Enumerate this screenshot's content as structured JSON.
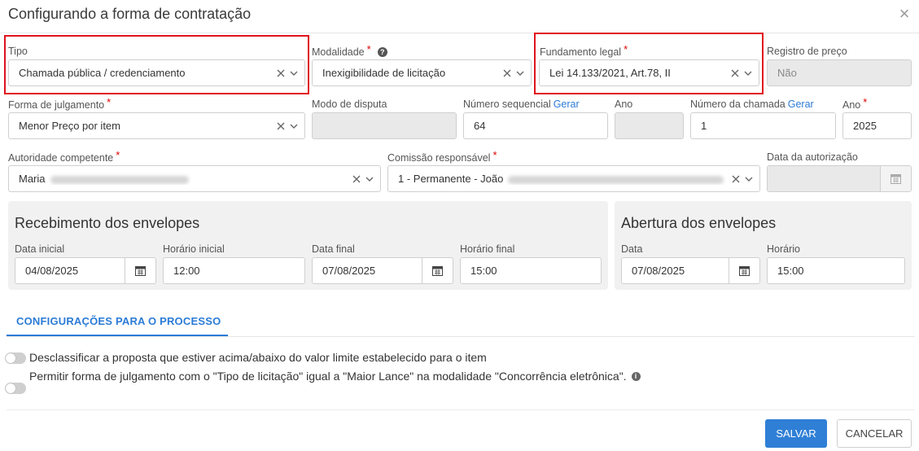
{
  "dialog": {
    "title": "Configurando a forma de contratação"
  },
  "fields": {
    "tipo": {
      "label": "Tipo",
      "value": "Chamada pública / credenciamento"
    },
    "modalidade": {
      "label": "Modalidade",
      "value": "Inexigibilidade de licitação"
    },
    "fundamento": {
      "label": "Fundamento legal",
      "value": "Lei 14.133/2021, Art.78, II"
    },
    "registro_preco": {
      "label": "Registro de preço",
      "value": "Não"
    },
    "forma_julgamento": {
      "label": "Forma de julgamento",
      "value": "Menor Preço por item"
    },
    "modo_disputa": {
      "label": "Modo de disputa",
      "value": ""
    },
    "numero_sequencial": {
      "label": "Número sequencial",
      "link": "Gerar",
      "value": "64"
    },
    "ano_seq": {
      "label": "Ano",
      "value": ""
    },
    "numero_chamada": {
      "label": "Número da chamada",
      "link": "Gerar",
      "value": "1"
    },
    "ano": {
      "label": "Ano",
      "value": "2025"
    },
    "autoridade": {
      "label": "Autoridade competente",
      "value": "Maria"
    },
    "comissao": {
      "label": "Comissão responsável",
      "value": "1 - Permanente - João"
    },
    "data_autorizacao": {
      "label": "Data da autorização",
      "value": ""
    }
  },
  "recebimento": {
    "title": "Recebimento dos envelopes",
    "data_inicial": {
      "label": "Data inicial",
      "value": "04/08/2025"
    },
    "horario_inicial": {
      "label": "Horário inicial",
      "value": "12:00"
    },
    "data_final": {
      "label": "Data final",
      "value": "07/08/2025"
    },
    "horario_final": {
      "label": "Horário final",
      "value": "15:00"
    }
  },
  "abertura": {
    "title": "Abertura dos envelopes",
    "data": {
      "label": "Data",
      "value": "07/08/2025"
    },
    "horario": {
      "label": "Horário",
      "value": "15:00"
    }
  },
  "tabs": {
    "config": "CONFIGURAÇÕES PARA O PROCESSO"
  },
  "options": [
    {
      "text": "Desclassificar a proposta que estiver acima/abaixo do valor limite estabelecido para o item",
      "enabled": false
    },
    {
      "text": "Permitir forma de julgamento com o \"Tipo de licitação\" igual a \"Maior Lance\" na modalidade \"Concorrência eletrônica\".",
      "enabled": false
    }
  ],
  "actions": {
    "save": "SALVAR",
    "cancel": "CANCELAR"
  },
  "colors": {
    "accent": "#2f7fd6",
    "highlight": "#e0121c",
    "required": "#dd0000"
  },
  "icons": {
    "close": "close-icon",
    "clear": "clear-icon",
    "chevron": "chevron-down-icon",
    "calendar": "calendar-icon",
    "help": "help-icon",
    "info": "info-icon"
  }
}
